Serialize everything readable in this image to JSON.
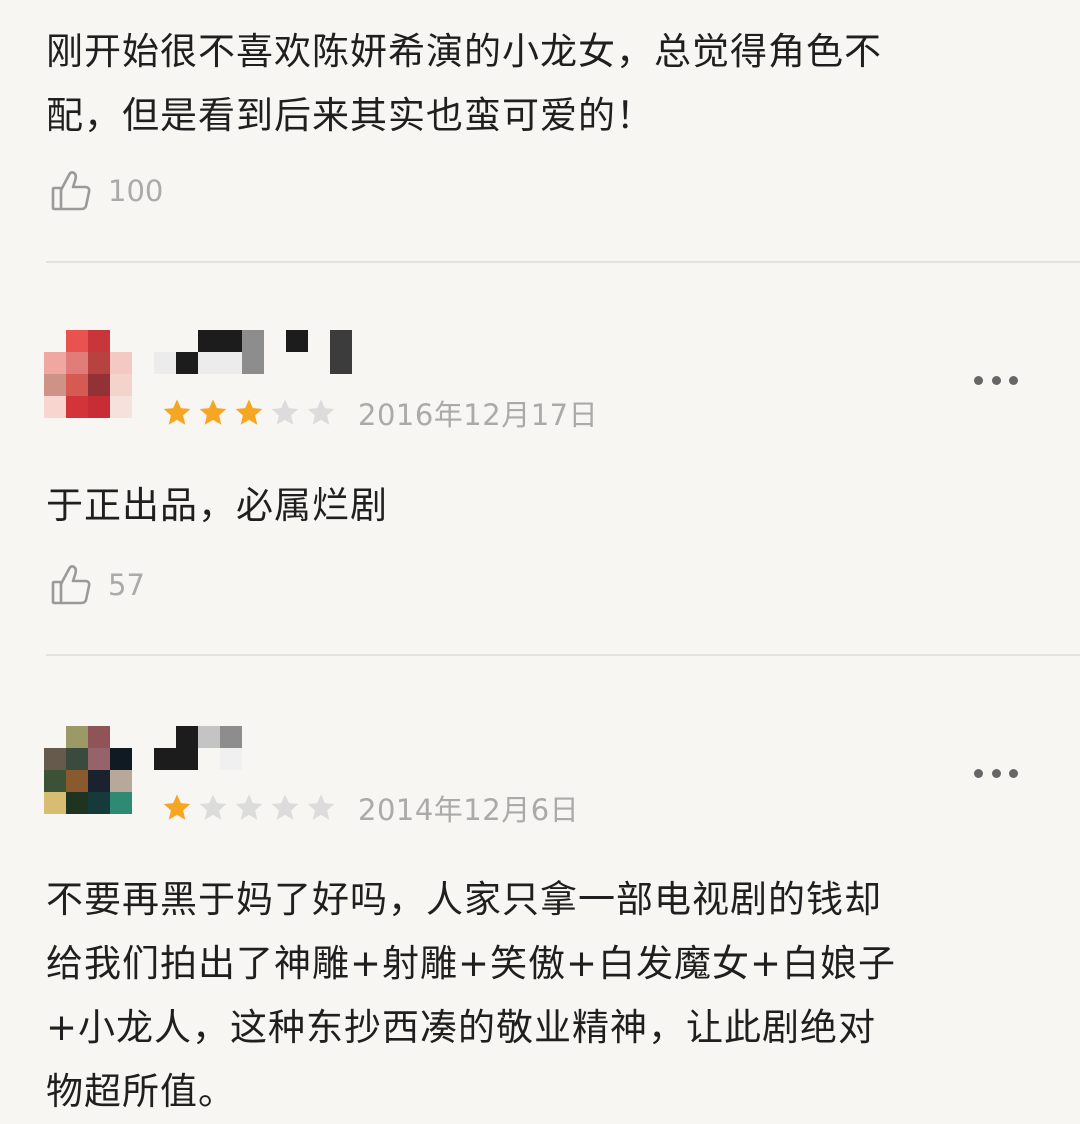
{
  "top_comment": {
    "text_line1": "刚开始很不喜欢陈妍希演的小龙女，总觉得角色不",
    "text_line2": "配，但是看到后来其实也蛮可爱的！",
    "like_count": "100"
  },
  "reviews": [
    {
      "rating": 3,
      "max_rating": 5,
      "date": "2016年12月17日",
      "text_line1": "于正出品，必属烂剧",
      "like_count": "57",
      "more_icon": "more-horizontal-icon"
    },
    {
      "rating": 1,
      "max_rating": 5,
      "date": "2014年12月6日",
      "text_line1": "不要再黑于妈了好吗，人家只拿一部电视剧的钱却",
      "text_line2": "给我们拍出了神雕+射雕+笑傲+白发魔女+白娘子",
      "text_line3": "+小龙人，这种东抄西凑的敬业精神，让此剧绝对",
      "text_line4": "物超所值。",
      "more_icon": "more-horizontal-icon"
    }
  ],
  "colors": {
    "background": "#f7f6f2",
    "star_filled": "#f5a623",
    "star_empty": "#dcdcdc",
    "muted_text": "#aaaaaa"
  },
  "icons": {
    "like": "thumbs-up-icon",
    "star": "star-icon",
    "more": "more-horizontal-icon"
  }
}
